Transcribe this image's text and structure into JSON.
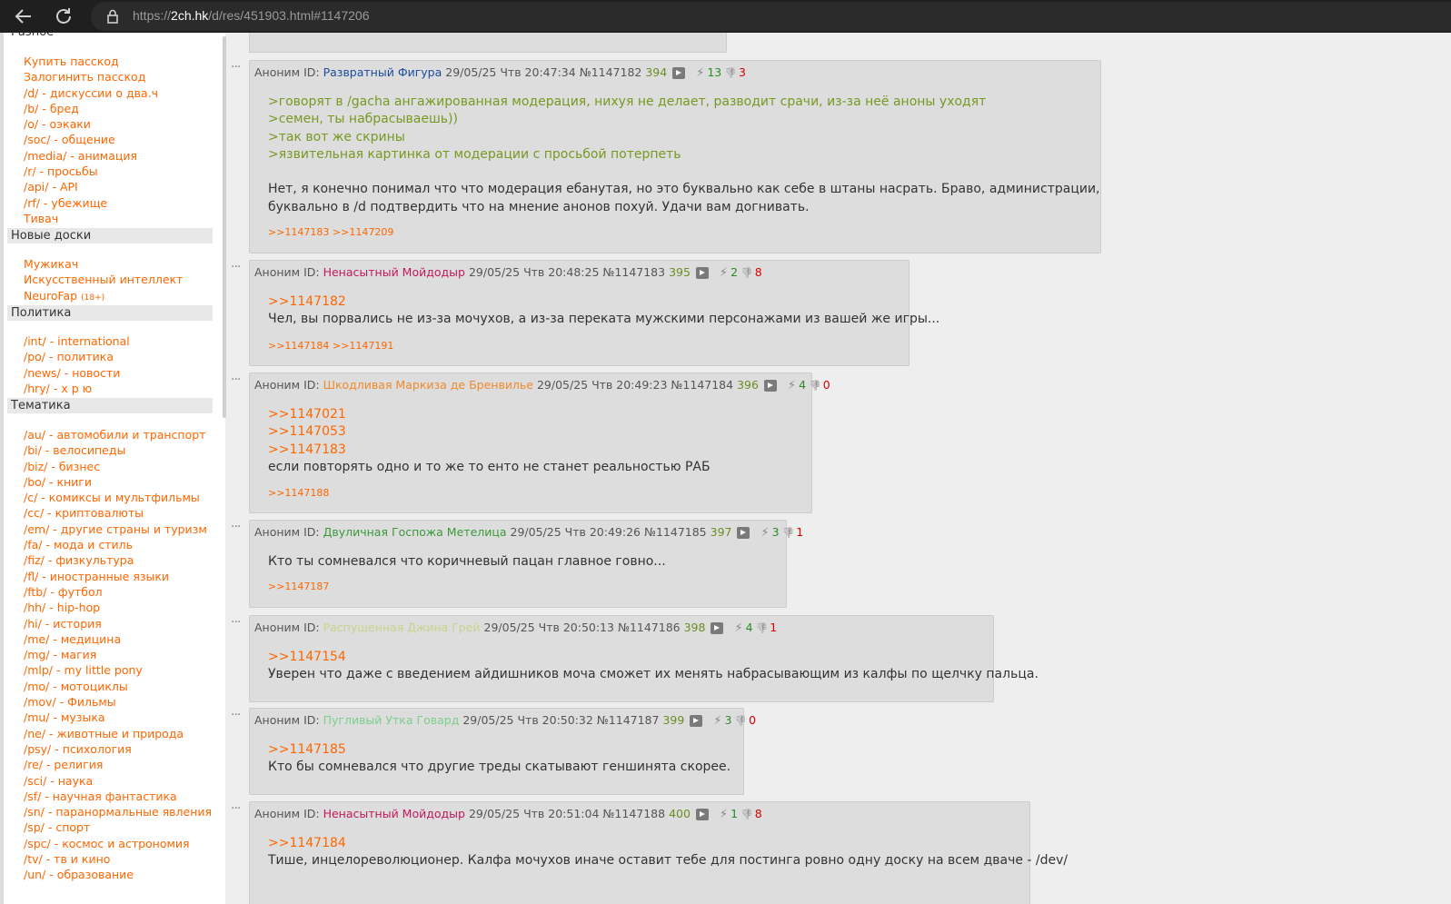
{
  "browser": {
    "url_host": "2ch.hk",
    "url_prefix": "https://",
    "url_path": "/d/res/451903.html#1147206"
  },
  "sidebar": {
    "sections": [
      {
        "title": "Разное",
        "items": [
          "Купить пасскод",
          "Залогинить пасскод",
          "/d/ - дискуссии о два.ч",
          "/b/ - бред",
          "/o/ - оэкаки",
          "/soc/ - общение",
          "/media/ - анимация",
          "/r/ - просьбы",
          "/api/ - API",
          "/rf/ - убежище",
          "Тивач"
        ]
      },
      {
        "title": "Новые доски",
        "items": [
          "Мужикач",
          "Искусственный интеллект",
          "NeuroFap"
        ],
        "tag": "(18+)"
      },
      {
        "title": "Политика",
        "items": [
          "/int/ - international",
          "/po/ - политика",
          "/news/ - новости",
          "/hry/ - х р ю"
        ]
      },
      {
        "title": "Тематика",
        "items": [
          "/au/ - автомобили и транспорт",
          "/bi/ - велосипеды",
          "/biz/ - бизнес",
          "/bo/ - книги",
          "/c/ - комиксы и мультфильмы",
          "/cc/ - криптовалюты",
          "/em/ - другие страны и туризм",
          "/fa/ - мода и стиль",
          "/fiz/ - физкультура",
          "/fl/ - иностранные языки",
          "/ftb/ - футбол",
          "/hh/ - hip-hop",
          "/hi/ - история",
          "/me/ - медицина",
          "/mg/ - магия",
          "/mlp/ - my little pony",
          "/mo/ - мотоциклы",
          "/mov/ - Фильмы",
          "/mu/ - музыка",
          "/ne/ - животные и природа",
          "/psy/ - психология",
          "/re/ - религия",
          "/sci/ - наука",
          "/sf/ - научная фантастика",
          "/sn/ - паранормальные явления",
          "/sp/ - спорт",
          "/spc/ - космос и астрономия",
          "/tv/ - тв и кино",
          "/un/ - образование"
        ]
      }
    ]
  },
  "posts": [
    {
      "anon": "Аноним ID:",
      "name": "Развратный Фигура",
      "name_color": "#1a4c9c",
      "date": "29/05/25 Чтв 20:47:34",
      "num": "№1147182",
      "count": "394",
      "likes": "13",
      "dislikes": "3",
      "lines": [
        {
          "t": ">говорят в /gacha ангажированная модерация, нихуя не делает, разводит срачи, из-за неё аноны уходят",
          "k": "quote"
        },
        {
          "t": ">семен, ты набрасываешь))",
          "k": "quote"
        },
        {
          "t": ">так вот же скрины",
          "k": "quote"
        },
        {
          "t": ">язвительная картинка от модерации с просьбой потерпеть",
          "k": "quote"
        },
        {
          "t": "",
          "k": "text"
        },
        {
          "t": "Нет, я конечно понимал что что модерация ебанутая, но это буквально как себе в штаны насрать. Браво, администрации,",
          "k": "text"
        },
        {
          "t": "буквально в /d подтвердить что на мнение анонов похуй. Удачи вам догнивать.",
          "k": "text"
        }
      ],
      "replies": ">>1147183 >>1147209"
    },
    {
      "anon": "Аноним ID:",
      "name": "Ненасытный Мойдодыр",
      "name_color": "#c2185b",
      "date": "29/05/25 Чтв 20:48:25",
      "num": "№1147183",
      "count": "395",
      "likes": "2",
      "dislikes": "8",
      "lines": [
        {
          "t": ">>1147182",
          "k": "link"
        },
        {
          "t": "Чел, вы порвались не из-за мочухов, а из-за переката мужскими персонажами из вашей же игры...",
          "k": "text"
        }
      ],
      "replies": ">>1147184 >>1147191"
    },
    {
      "anon": "Аноним ID:",
      "name": "Шкодливая Маркиза де Бренвилье",
      "name_color": "#ef8a2a",
      "date": "29/05/25 Чтв 20:49:23",
      "num": "№1147184",
      "count": "396",
      "likes": "4",
      "dislikes": "0",
      "lines": [
        {
          "t": ">>1147021",
          "k": "link"
        },
        {
          "t": ">>1147053",
          "k": "link"
        },
        {
          "t": ">>1147183",
          "k": "link"
        },
        {
          "t": "если повторять одно и то же то енто не станет реальностью РАБ",
          "k": "text"
        }
      ],
      "replies": ">>1147188"
    },
    {
      "anon": "Аноним ID:",
      "name": "Двуличная Госпожа Метелица",
      "name_color": "#3a9a3a",
      "date": "29/05/25 Чтв 20:49:26",
      "num": "№1147185",
      "count": "397",
      "likes": "3",
      "dislikes": "1",
      "lines": [
        {
          "t": "Кто ты сомневался что коричневый пацан главное говно...",
          "k": "text"
        }
      ],
      "replies": ">>1147187"
    },
    {
      "anon": "Аноним ID:",
      "name": "Распущенная Джина Грей",
      "name_color": "#c8d48a",
      "date": "29/05/25 Чтв 20:50:13",
      "num": "№1147186",
      "count": "398",
      "likes": "4",
      "dislikes": "1",
      "lines": [
        {
          "t": ">>1147154",
          "k": "link"
        },
        {
          "t": "Уверен что даже с введением айдишников моча сможет их менять набрасывающим из калфы по щелчку пальца.",
          "k": "text"
        }
      ],
      "replies": ""
    },
    {
      "anon": "Аноним ID:",
      "name": "Пугливый Утка Говард",
      "name_color": "#7ccf8a",
      "date": "29/05/25 Чтв 20:50:32",
      "num": "№1147187",
      "count": "399",
      "likes": "3",
      "dislikes": "0",
      "lines": [
        {
          "t": ">>1147185",
          "k": "link"
        },
        {
          "t": "Кто бы сомневался что другие треды скатывают геншинята скорее.",
          "k": "text"
        }
      ],
      "replies": ""
    },
    {
      "anon": "Аноним ID:",
      "name": "Ненасытный Мойдодыр",
      "name_color": "#c2185b",
      "date": "29/05/25 Чтв 20:51:04",
      "num": "№1147188",
      "count": "400",
      "likes": "1",
      "dislikes": "8",
      "lines": [
        {
          "t": ">>1147184",
          "k": "link"
        },
        {
          "t": "Тише, инцелореволюционер. Калфа мочухов иначе оставит тебе для постинга ровно одну доску на всем дваче - /dev/",
          "k": "text"
        }
      ],
      "replies": ""
    }
  ],
  "icons": {
    "back": "back-arrow-icon",
    "reload": "reload-icon",
    "lock": "lock-icon",
    "play": "play-icon",
    "like": "thumbs-up-icon",
    "dislike": "thumbs-down-icon",
    "menu": "ellipsis-icon"
  },
  "colors": {
    "link": "#ff6600",
    "quote": "#789922",
    "count": "#6b8e23",
    "likes": "#2a8a2a",
    "dislikes": "#dd0000",
    "post_bg": "#dddddd"
  }
}
